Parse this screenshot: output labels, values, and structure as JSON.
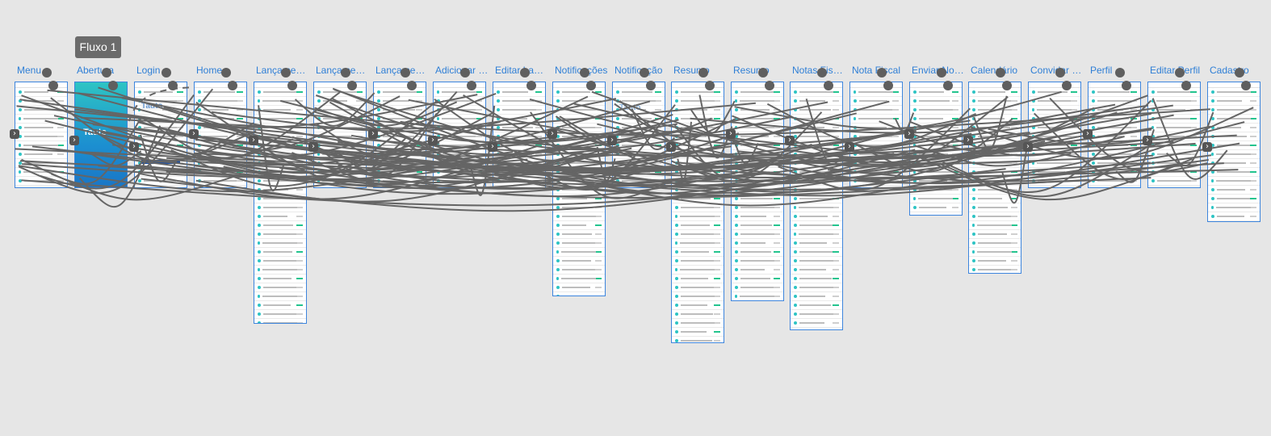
{
  "flow": {
    "label": "Fluxo 1"
  },
  "colors": {
    "canvas": "#e6e6e6",
    "label": "#2f7fd6",
    "frame_border": "#3d85dd",
    "connector": "#656565",
    "teal": "#2ec4c4",
    "blue": "#1f4f9e",
    "green": "#23c48e",
    "red": "#e04444",
    "orange": "#f39a55"
  },
  "screens": [
    {
      "label": "Menu"
    },
    {
      "label": "Abertura"
    },
    {
      "label": "Login"
    },
    {
      "label": "Home"
    },
    {
      "label": "Lançamentos"
    },
    {
      "label": "Lançament..."
    },
    {
      "label": "Lançament..."
    },
    {
      "label": "Adicionar L..."
    },
    {
      "label": "Editar Lanç..."
    },
    {
      "label": "Notificações"
    },
    {
      "label": "Notificação"
    },
    {
      "label": "Resumo"
    },
    {
      "label": "Resumo"
    },
    {
      "label": "Notas Fiscais"
    },
    {
      "label": "Nota Fiscal"
    },
    {
      "label": "Enviar Nota..."
    },
    {
      "label": "Calendário"
    },
    {
      "label": "Convidar C..."
    },
    {
      "label": "Perfil"
    },
    {
      "label": "Editar Perfil"
    },
    {
      "label": "Cadastro"
    }
  ],
  "brand": {
    "logo_text": "Tauto"
  }
}
